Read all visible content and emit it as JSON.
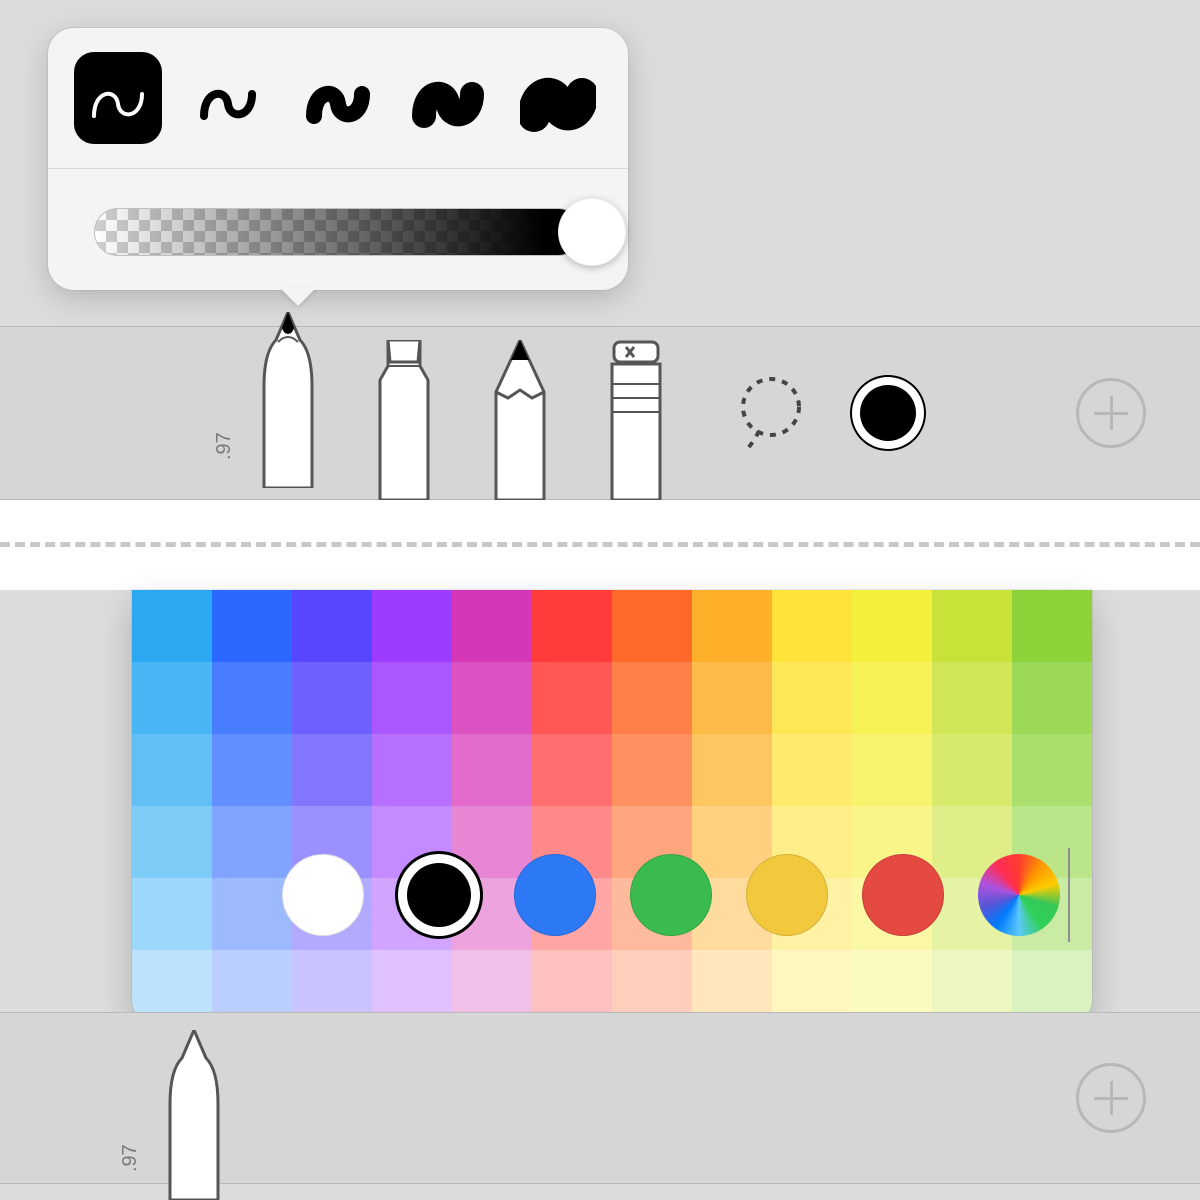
{
  "strokePopover": {
    "strokes": [
      {
        "name": "stroke-thin",
        "width": 4
      },
      {
        "name": "stroke-light",
        "width": 8
      },
      {
        "name": "stroke-medium",
        "width": 16
      },
      {
        "name": "stroke-heavy",
        "width": 24
      },
      {
        "name": "stroke-bold",
        "width": 32
      }
    ],
    "selectedIndex": 0,
    "opacityPercent": 89
  },
  "toolTray": {
    "tools": [
      {
        "name": "pen-tool",
        "label": ".97",
        "selected": true
      },
      {
        "name": "marker-tool",
        "label": ""
      },
      {
        "name": "pencil-tool",
        "label": ""
      },
      {
        "name": "eraser-tool",
        "label": ""
      }
    ],
    "lassoName": "lasso-tool",
    "currentColor": "#000000",
    "addButton": "add-tool-button"
  },
  "paletteHues": [
    "#2aa9f2",
    "#2b68ff",
    "#5646ff",
    "#9c3cff",
    "#d636b8",
    "#ff3b3b",
    "#ff6a2a",
    "#ffb02a",
    "#ffe23a",
    "#f4ef3a",
    "#c9e23a",
    "#8cd33a"
  ],
  "paletteLightness": [
    1.0,
    0.86,
    0.74,
    0.6,
    0.46,
    0.32
  ],
  "colorDots": [
    {
      "name": "color-white",
      "color": "#ffffff",
      "selected": false
    },
    {
      "name": "color-black",
      "color": "#000000",
      "selected": true
    },
    {
      "name": "color-blue",
      "color": "#2d78f4",
      "selected": false
    },
    {
      "name": "color-green",
      "color": "#3abb4f",
      "selected": false
    },
    {
      "name": "color-yellow",
      "color": "#f2c93d",
      "selected": false
    },
    {
      "name": "color-red",
      "color": "#e44a42",
      "selected": false
    }
  ],
  "bottomPenLabel": ".97"
}
